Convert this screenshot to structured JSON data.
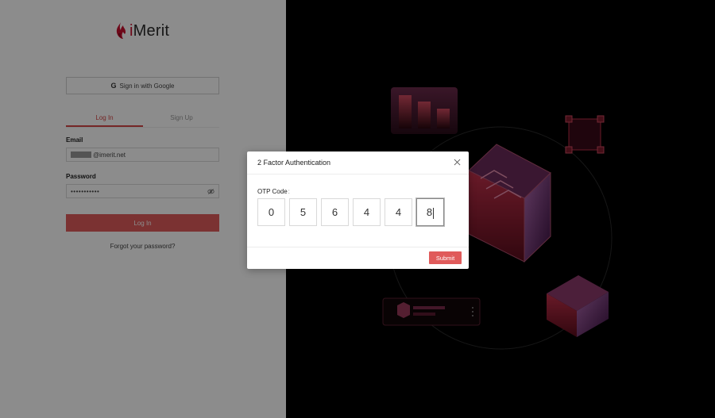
{
  "brand": {
    "name_i": "i",
    "name_rest": "Merit"
  },
  "login": {
    "google_label": "Sign in with Google",
    "google_glyph": "G",
    "tabs": [
      {
        "label": "Log In",
        "active": true
      },
      {
        "label": "Sign Up",
        "active": false
      }
    ],
    "email_label": "Email",
    "email_value": "@imerit.net",
    "password_label": "Password",
    "password_value": "•••••••••••",
    "login_button": "Log In",
    "forgot_link": "Forgot your password?"
  },
  "modal": {
    "title": "2 Factor Authentication",
    "otp_label": "OTP Code",
    "otp_colon": ":",
    "digits": [
      "0",
      "5",
      "6",
      "4",
      "4",
      "8"
    ],
    "submit": "Submit"
  },
  "colors": {
    "accent": "#e05b5b",
    "brand_red": "#c8102e",
    "active_tab": "#d64545"
  },
  "icons": [
    "flame-logo-icon",
    "google-icon",
    "eye-off-icon",
    "close-icon"
  ]
}
